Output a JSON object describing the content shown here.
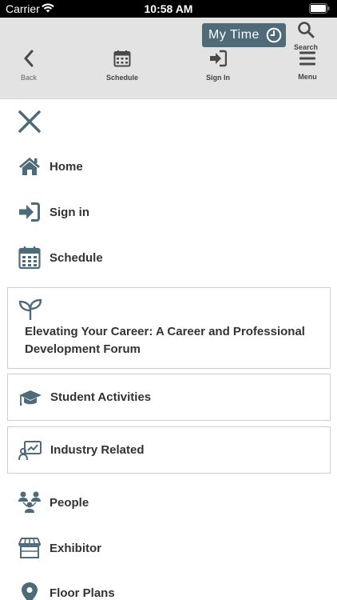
{
  "status_bar": {
    "carrier": "Carrier",
    "time": "10:58 AM"
  },
  "toolbar": {
    "my_time": "My Time",
    "search": "Search",
    "back": "Back",
    "schedule": "Schedule",
    "sign_in": "Sign In",
    "menu": "Menu"
  },
  "menu": {
    "home": "Home",
    "sign_in": "Sign in",
    "schedule": "Schedule",
    "career_forum": "Elevating Your Career: A Career and Professional Development Forum",
    "student_activities": "Student Activities",
    "industry_related": "Industry Related",
    "people": "People",
    "exhibitor": "Exhibitor",
    "floor_plans": "Floor Plans"
  },
  "colors": {
    "accent": "#4f6b79",
    "toolbar_bg": "#e3e3e3",
    "icon": "#4f6b79"
  }
}
